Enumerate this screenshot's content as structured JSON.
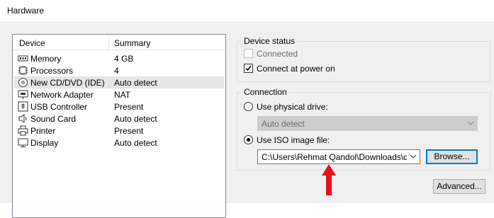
{
  "window": {
    "title": "Hardware"
  },
  "device_list": {
    "columns": [
      "Device",
      "Summary"
    ],
    "rows": [
      {
        "icon": "memory-icon",
        "device": "Memory",
        "summary": "4 GB",
        "selected": false
      },
      {
        "icon": "processor-icon",
        "device": "Processors",
        "summary": "4",
        "selected": false
      },
      {
        "icon": "cd-dvd-icon",
        "device": "New CD/DVD (IDE)",
        "summary": "Auto detect",
        "selected": true
      },
      {
        "icon": "network-adapter-icon",
        "device": "Network Adapter",
        "summary": "NAT",
        "selected": false
      },
      {
        "icon": "usb-icon",
        "device": "USB Controller",
        "summary": "Present",
        "selected": false
      },
      {
        "icon": "sound-card-icon",
        "device": "Sound Card",
        "summary": "Auto detect",
        "selected": false
      },
      {
        "icon": "printer-icon",
        "device": "Printer",
        "summary": "Present",
        "selected": false
      },
      {
        "icon": "display-icon",
        "device": "Display",
        "summary": "Auto detect",
        "selected": false
      }
    ]
  },
  "device_status": {
    "label": "Device status",
    "connected_label": "Connected",
    "connected_checked": false,
    "connected_enabled": false,
    "connect_power_on_label": "Connect at power on",
    "connect_power_on_checked": true
  },
  "connection": {
    "label": "Connection",
    "physical_drive_label": "Use physical drive:",
    "physical_drive_selected": false,
    "physical_drive_value": "Auto detect",
    "iso_label": "Use ISO image file:",
    "iso_selected": true,
    "iso_path": "C:\\Users\\Rehmat Qandol\\Downloads\\debia",
    "browse_label": "Browse..."
  },
  "advanced_label": "Advanced...",
  "colors": {
    "annotation_arrow": "#e8101b",
    "focus_border": "#0078d7"
  }
}
